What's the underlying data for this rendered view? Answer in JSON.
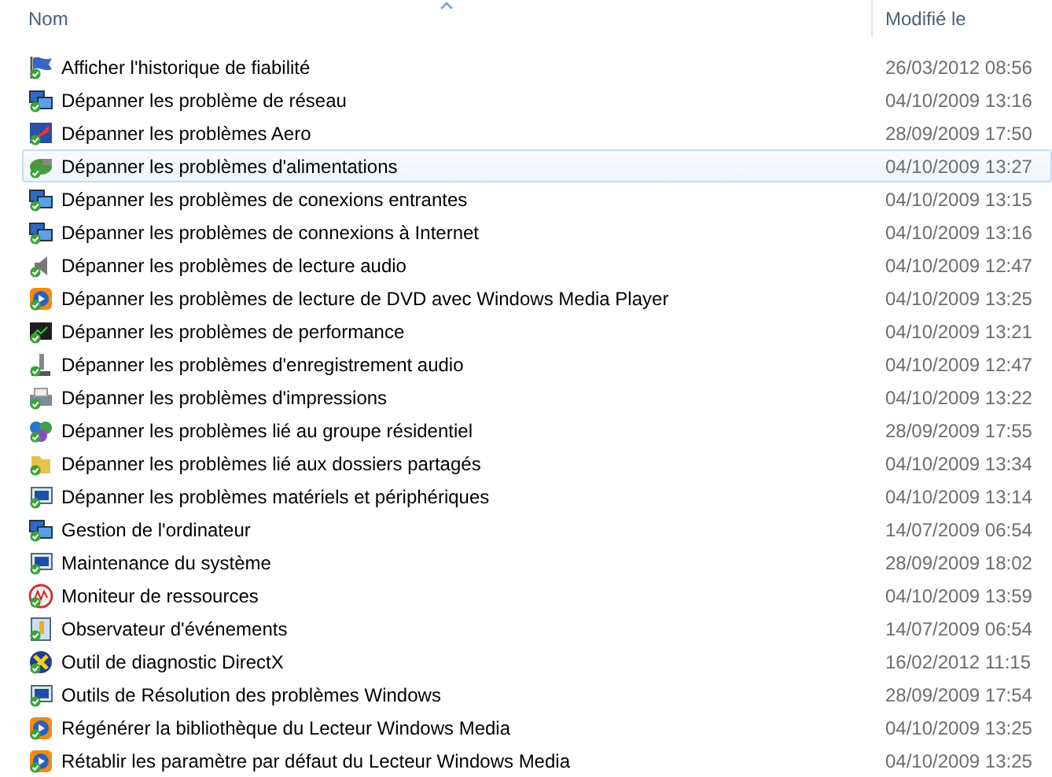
{
  "columns": [
    {
      "label": "Nom"
    },
    {
      "label": "Modifié le"
    }
  ],
  "rows": [
    {
      "name": "Afficher l'historique de fiabilité",
      "modified": "26/03/2012 08:56",
      "kind": "flag",
      "highlighted": false
    },
    {
      "name": "Dépanner les problème de réseau",
      "modified": "04/10/2009 13:16",
      "kind": "network",
      "highlighted": false
    },
    {
      "name": "Dépanner les problèmes Aero",
      "modified": "28/09/2009 17:50",
      "kind": "aero",
      "highlighted": false
    },
    {
      "name": "Dépanner les problèmes d'alimentations",
      "modified": "04/10/2009 13:27",
      "kind": "power",
      "highlighted": true
    },
    {
      "name": "Dépanner les problèmes de conexions entrantes",
      "modified": "04/10/2009 13:15",
      "kind": "network",
      "highlighted": false
    },
    {
      "name": "Dépanner les problèmes de connexions à Internet",
      "modified": "04/10/2009 13:16",
      "kind": "network",
      "highlighted": false
    },
    {
      "name": "Dépanner les problèmes de lecture audio",
      "modified": "04/10/2009 12:47",
      "kind": "speaker",
      "highlighted": false
    },
    {
      "name": "Dépanner les problèmes de lecture de DVD avec Windows Media Player",
      "modified": "04/10/2009 13:25",
      "kind": "media",
      "highlighted": false
    },
    {
      "name": "Dépanner les problèmes de performance",
      "modified": "04/10/2009 13:21",
      "kind": "monitor",
      "highlighted": false
    },
    {
      "name": "Dépanner les problèmes d'enregistrement audio",
      "modified": "04/10/2009 12:47",
      "kind": "mic",
      "highlighted": false
    },
    {
      "name": "Dépanner les problèmes d'impressions",
      "modified": "04/10/2009 13:22",
      "kind": "printer",
      "highlighted": false
    },
    {
      "name": "Dépanner les problèmes lié au groupe résidentiel",
      "modified": "28/09/2009 17:55",
      "kind": "group",
      "highlighted": false
    },
    {
      "name": "Dépanner les problèmes lié aux dossiers partagés",
      "modified": "04/10/2009 13:34",
      "kind": "folder",
      "highlighted": false
    },
    {
      "name": "Dépanner les problèmes matériels et périphériques",
      "modified": "04/10/2009 13:14",
      "kind": "screen",
      "highlighted": false
    },
    {
      "name": "Gestion de l'ordinateur",
      "modified": "14/07/2009 06:54",
      "kind": "network",
      "highlighted": false
    },
    {
      "name": "Maintenance du système",
      "modified": "28/09/2009 18:02",
      "kind": "screen",
      "highlighted": false
    },
    {
      "name": "Moniteur de ressources",
      "modified": "04/10/2009 13:59",
      "kind": "gauge",
      "highlighted": false
    },
    {
      "name": "Observateur d'événements",
      "modified": "14/07/2009 06:54",
      "kind": "events",
      "highlighted": false
    },
    {
      "name": "Outil de diagnostic DirectX",
      "modified": "16/02/2012 11:15",
      "kind": "directx",
      "highlighted": false
    },
    {
      "name": "Outils de Résolution des problèmes Windows",
      "modified": "28/09/2009 17:54",
      "kind": "screen",
      "highlighted": false
    },
    {
      "name": "Régénérer la bibliothèque du Lecteur Windows Media",
      "modified": "04/10/2009 13:25",
      "kind": "media",
      "highlighted": false
    },
    {
      "name": "Rétablir les paramètre par défaut du Lecteur Windows Media",
      "modified": "04/10/2009 13:25",
      "kind": "media",
      "highlighted": false
    }
  ]
}
